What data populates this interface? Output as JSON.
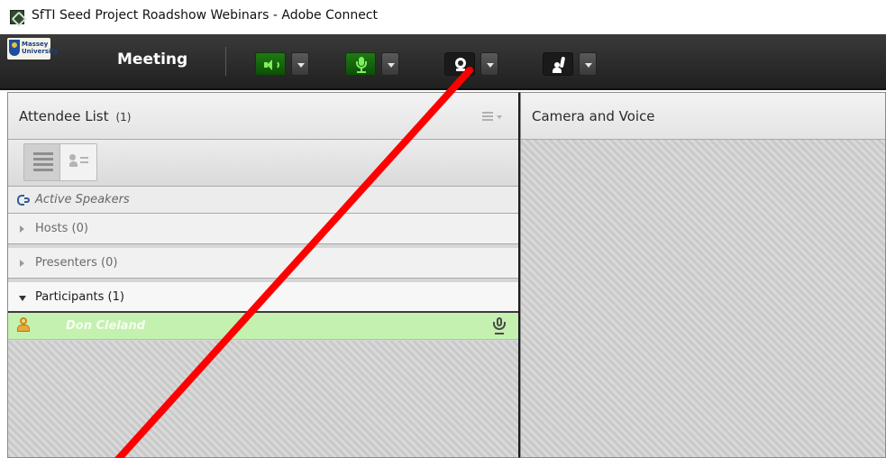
{
  "window": {
    "title": "SfTI Seed Project Roadshow Webinars - Adobe Connect",
    "icon": "adobe-connect-icon"
  },
  "toolbar": {
    "logo_text": "Massey\nUniversity",
    "menu_label": "Meeting",
    "buttons": [
      {
        "icon": "speaker-icon",
        "state": "on"
      },
      {
        "icon": "microphone-icon",
        "state": "on"
      },
      {
        "icon": "webcam-icon",
        "state": "off"
      },
      {
        "icon": "raise-hand-icon",
        "state": "off"
      }
    ],
    "accent_on": "#1f7a14",
    "icon_on": "#7ef05a"
  },
  "attendee_pod": {
    "title": "Attendee List",
    "count": "(1)",
    "view_modes": [
      "list-view-icon",
      "user-view-icon"
    ],
    "active_speakers_label": "Active Speakers",
    "sections": [
      {
        "label": "Hosts (0)",
        "expanded": false
      },
      {
        "label": "Presenters (0)",
        "expanded": false
      },
      {
        "label": "Participants (1)",
        "expanded": true
      }
    ],
    "attendees": [
      {
        "name": "Don Cleland",
        "role": "participant",
        "highlight": "#c4f0b0"
      }
    ]
  },
  "camera_pod": {
    "title": "Camera and Voice"
  },
  "annotation": {
    "color": "#ff0000"
  }
}
